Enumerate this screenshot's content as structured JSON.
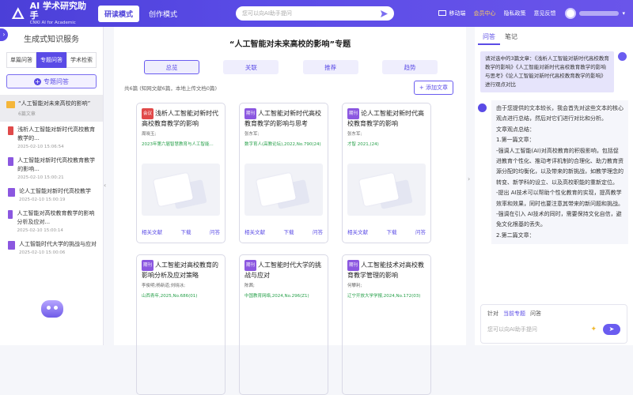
{
  "app": {
    "title": "AI 学术研究助手",
    "subtitle": "CNKI AI for Academic",
    "modes": [
      "研读模式",
      "创作模式"
    ],
    "active_mode": 0
  },
  "search": {
    "placeholder": "您可以向AI助手提问"
  },
  "header_links": [
    "移动端",
    "会员中心",
    "隐私政策",
    "意见反馈"
  ],
  "left": {
    "title": "生成式知识服务",
    "tabs": [
      "单篇问答",
      "专题问答",
      "学术检索"
    ],
    "topic_button": "专题问答",
    "folder": {
      "title": "“人工智能对未来高校的影响”",
      "count": "6篇文章"
    },
    "docs": [
      {
        "title": "浅析人工智能对新时代高校教育教学的...",
        "date": "2025-02-10 15:06:54",
        "type": "pdf"
      },
      {
        "title": "人工智能对新时代高校教育教学的影响...",
        "date": "2025-02-10 15:00:21",
        "type": "cnki"
      },
      {
        "title": "论人工智能对新时代高校教学",
        "date": "2025-02-10 15:00:19",
        "type": "cnki"
      },
      {
        "title": "人工智能对高校教育教学的影响分析及应对...",
        "date": "2025-02-10 15:00:14",
        "type": "cnki"
      },
      {
        "title": "人工智能时代大学的挑战与应对",
        "date": "2025-02-10 15:00:06",
        "type": "cnki"
      }
    ]
  },
  "main": {
    "title": "“人工智能对未来高校的影响”专题",
    "tabs": [
      "总览",
      "关联",
      "推荐",
      "趋势"
    ],
    "count": "共6篇 (知网文献6篇，本地上传文档0篇)",
    "add_label": "添加文章",
    "actions": [
      "相关文献",
      "下载",
      "问答"
    ],
    "cards": [
      {
        "tag": "会议",
        "title": "浅析人工智能对新时代高校教育教学的影响",
        "author": "周晓玉;",
        "source": "2023年第六届智慧教育与人工智能..."
      },
      {
        "tag": "期刊",
        "title": "人工智能对新时代高校教育教学的影响与思考",
        "author": "张东军;",
        "source": "数字育人(高教论坛),2022,No.790(24)"
      },
      {
        "tag": "期刊",
        "title": "论人工智能对新时代高校教育教学的影响",
        "author": "张东军;",
        "source": "才智 2021,(24)"
      },
      {
        "tag": "期刊",
        "title": "人工智能对高校教育的影响分析及应对策略",
        "author": "李俊明;杨新道;刘晓冰;",
        "source": "山西青年,2025,No.686(01)"
      },
      {
        "tag": "期刊",
        "title": "人工智能时代大学的挑战与应对",
        "author": "陈茜;",
        "source": "中国教育网络,2024,No.296(Z1)"
      },
      {
        "tag": "期刊",
        "title": "人工智能技术对高校教育教学管理的影响",
        "author": "何攀利;",
        "source": "辽宁开放大学学报,2024,No.172(03)"
      }
    ]
  },
  "right": {
    "tabs": [
      "问答",
      "笔记"
    ],
    "user_msg": "请对选中的3篇文章：《浅析人工智能对新时代高校教育教学的影响》《人工智能对新时代高校教育教学的影响与思考》《论人工智能对新时代高校教育教学的影响》进行观点对比",
    "answer": [
      "由于您提供的文本较长，我会首先对这些文本的核心观点进行总结，然后对它们进行对比和分析。",
      "文章观点总结：",
      "1.第一篇文章：",
      "-强调人工智能(AI)对高校教育的积极影响，包括促进教育个性化、推动考评机制的合理化、助力教育资源分配的均衡化，以及带来的新挑战，如教学理念的转变、新学科的设立、以及高校职能的重新定位。",
      "-提出 AI技术可以帮助个性化教育的实现，提高教学效率和效果，同时也要注意其带来的新问题和挑战。",
      "-强调在引入 AI技术的同时，需要保持文化自信，避免文化根基的丢失。",
      "2.第二篇文章："
    ],
    "scope": [
      "针对",
      "当前专题",
      "问答"
    ],
    "input_placeholder": "您可以向AI助手提问"
  },
  "colors": {
    "accent": "#5a4be6",
    "source_green": "#27a04a",
    "tag_red": "#e04a4a",
    "tag_purple": "#8b57e0"
  }
}
